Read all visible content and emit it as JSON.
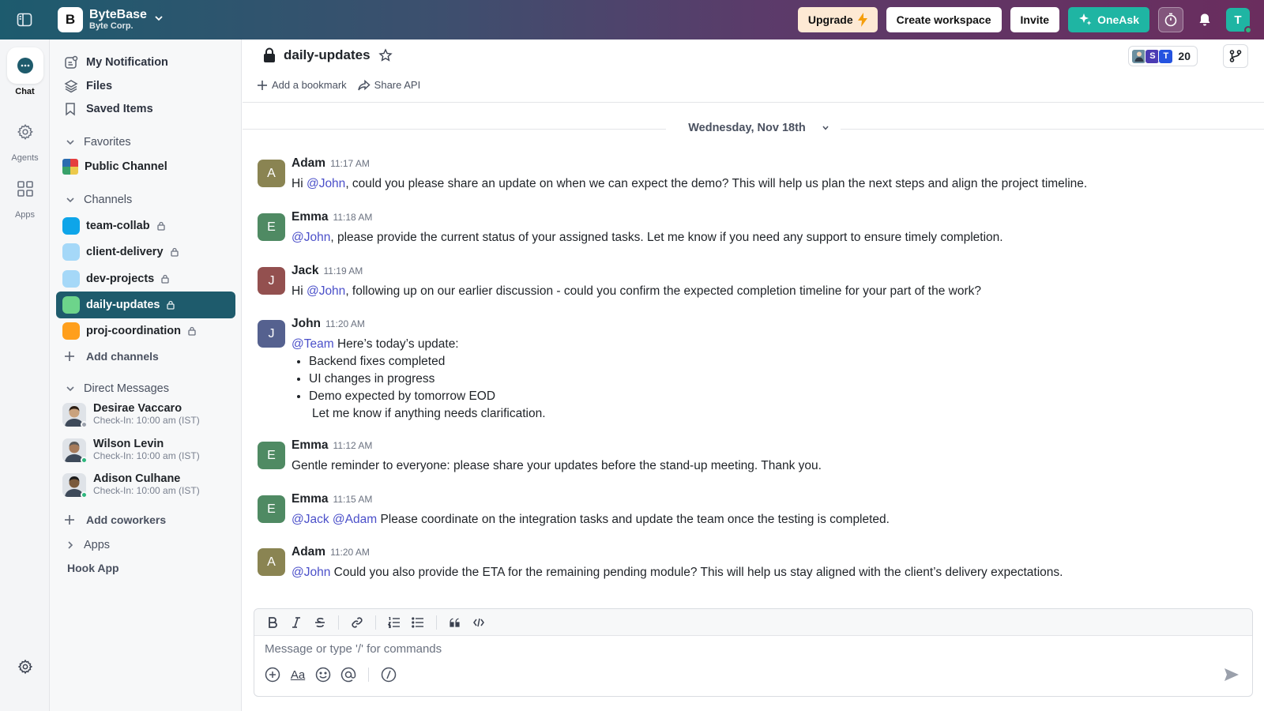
{
  "workspace": {
    "initial": "B",
    "name": "ByteBase",
    "org": "Byte Corp."
  },
  "topbar": {
    "upgrade_label": "Upgrade",
    "create_workspace_label": "Create workspace",
    "invite_label": "Invite",
    "oneask_label": "OneAsk",
    "user_initial": "T"
  },
  "rail": {
    "chat_label": "Chat",
    "agents_label": "Agents",
    "apps_label": "Apps"
  },
  "sidebar": {
    "top_items": [
      {
        "label": "My Notification",
        "icon": "notification-icon"
      },
      {
        "label": "Files",
        "icon": "layers-icon"
      },
      {
        "label": "Saved Items",
        "icon": "bookmark-icon"
      }
    ],
    "favorites_label": "Favorites",
    "favorites": [
      {
        "label": "Public Channel"
      }
    ],
    "channels_label": "Channels",
    "channels": [
      {
        "label": "team-collab",
        "color": "#0ea5e9"
      },
      {
        "label": "client-delivery",
        "color": "#a5d8f8"
      },
      {
        "label": "dev-projects",
        "color": "#a5d8f8"
      },
      {
        "label": "daily-updates",
        "color": "#6dd48b"
      },
      {
        "label": "proj-coordination",
        "color": "#ff9f1c"
      }
    ],
    "add_channels_label": "Add channels",
    "dm_label": "Direct Messages",
    "dms": [
      {
        "name": "Desirae Vaccaro",
        "status": "Check-In: 10:00 am (IST)",
        "status_color": "#9aa0ab"
      },
      {
        "name": "Wilson Levin",
        "status": "Check-In: 10:00 am (IST)",
        "status_color": "#2eb67d"
      },
      {
        "name": "Adison Culhane",
        "status": "Check-In: 10:00 am (IST)",
        "status_color": "#2eb67d"
      }
    ],
    "add_coworkers_label": "Add coworkers",
    "apps_label": "Apps",
    "hook_app_label": "Hook App"
  },
  "channel": {
    "name": "daily-updates",
    "add_bookmark_label": "Add a bookmark",
    "share_api_label": "Share API",
    "member_initials": [
      "S",
      "T"
    ],
    "member_count": "20"
  },
  "date_divider": "Wednesday, Nov 18th",
  "messages": [
    {
      "author": "Adam",
      "initial": "A",
      "color": "#8a8452",
      "time": "11:17 AM",
      "mention": "@John",
      "pre": "Hi ",
      "text": ", could you please share an update on when we can expect the demo? This will help us plan the next steps and align the project timeline."
    },
    {
      "author": "Emma",
      "initial": "E",
      "color": "#4f8a63",
      "time": "11:18 AM",
      "mention": "@John",
      "pre": "",
      "text": ", please provide the current status of your assigned tasks. Let me know if you need any support to ensure timely completion."
    },
    {
      "author": "Jack",
      "initial": "J",
      "color": "#93504f",
      "time": "11:19 AM",
      "mention": "@John",
      "pre": "Hi ",
      "text": ", following up on our earlier discussion - could you confirm the expected completion timeline for your part of the work?"
    },
    {
      "author": "John",
      "initial": "J",
      "color": "#55618f",
      "time": "11:20 AM",
      "mention": "@Team",
      "pre": "",
      "text": " Here’s today’s update:",
      "list": [
        "Backend fixes completed",
        "UI changes in progress",
        "Demo expected by tomorrow EOD"
      ],
      "after": "Let me know if anything needs clarification."
    },
    {
      "author": "Emma",
      "initial": "E",
      "color": "#4f8a63",
      "time": "11:12 AM",
      "mention": "",
      "pre": "",
      "text": "Gentle reminder to everyone: please share your updates before the stand-up meeting. Thank you."
    },
    {
      "author": "Emma",
      "initial": "E",
      "color": "#4f8a63",
      "time": "11:15 AM",
      "mention": "@Jack @Adam",
      "pre": "",
      "text": " Please coordinate on the integration tasks and update the team once the testing is completed."
    },
    {
      "author": "Adam",
      "initial": "A",
      "color": "#8a8452",
      "time": "11:20 AM",
      "mention": "@John",
      "pre": "",
      "text": " Could you also provide the ETA for the remaining pending module? This will help us stay aligned with the client’s delivery expectations."
    }
  ],
  "composer": {
    "placeholder": "Message or type '/' for commands",
    "format_label": "Aa"
  }
}
